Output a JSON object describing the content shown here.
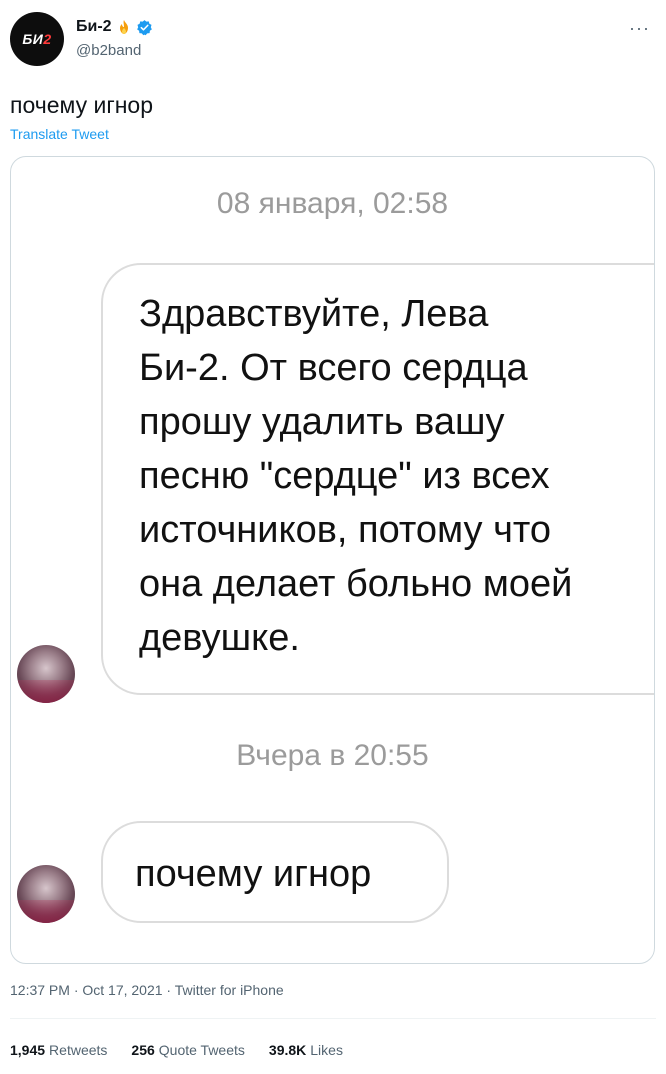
{
  "author": {
    "display_name": "Би-2",
    "handle": "@b2band",
    "avatar_logo": "БИ",
    "avatar_logo_num": "2",
    "badge_icon": "fire-icon",
    "verified_icon": "verified-badge-icon"
  },
  "more_label": "···",
  "tweet": {
    "text": "почему игнор",
    "translate_label": "Translate Tweet"
  },
  "screenshot": {
    "date_1": "08 января, 02:58",
    "message_1_lines": [
      "Здравствуйте, Лева",
      "Би-2. От всего сердца",
      "прошу удалить вашу",
      "песню \"сердце\" из всех",
      "источников, потому что",
      "она делает больно моей",
      "девушке."
    ],
    "date_2": "Вчера в 20:55",
    "message_2": "почему игнор"
  },
  "meta": {
    "timestamp": "12:37 PM · Oct 17, 2021 · Twitter for iPhone"
  },
  "stats": {
    "retweets_count": "1,945",
    "retweets_label": "Retweets",
    "quotes_count": "256",
    "quotes_label": "Quote Tweets",
    "likes_count": "39.8K",
    "likes_label": "Likes"
  },
  "colors": {
    "link": "#1d9bf0",
    "secondary_text": "#536471",
    "verified": "#1d9bf0",
    "bubble_border": "#dcdcdc",
    "date_gray": "#9b9b9b"
  }
}
